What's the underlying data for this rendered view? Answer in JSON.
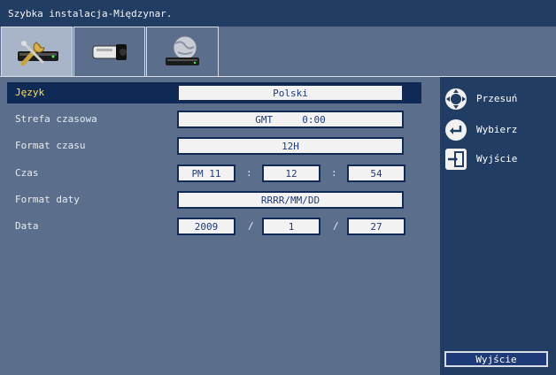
{
  "window": {
    "title": "Szybka instalacja-Międzynar."
  },
  "tabs": [
    {
      "name": "tools-tab",
      "icon": "wrench-device-icon",
      "active": true
    },
    {
      "name": "camera-tab",
      "icon": "camera-icon",
      "active": false
    },
    {
      "name": "network-tab",
      "icon": "globe-network-icon",
      "active": false
    }
  ],
  "settings": {
    "language": {
      "label": "Język",
      "value": "Polski"
    },
    "timezone": {
      "label": "Strefa czasowa",
      "value": "GMT     0:00"
    },
    "time_format": {
      "label": "Format czasu",
      "value": "12H"
    },
    "time": {
      "label": "Czas",
      "hour": "PM 11",
      "minute": "12",
      "second": "54",
      "sep": ":"
    },
    "date_format": {
      "label": "Format daty",
      "value": "RRRR/MM/DD"
    },
    "date": {
      "label": "Data",
      "year": "2009",
      "month": "1",
      "day": "27",
      "sep": "/"
    }
  },
  "sidebar": {
    "move": {
      "label": "Przesuń",
      "icon": "dpad-icon"
    },
    "select": {
      "label": "Wybierz",
      "icon": "enter-icon"
    },
    "exit": {
      "label": "Wyjście",
      "icon": "exit-icon"
    },
    "exit_button": "Wyjście"
  },
  "colors": {
    "title_bar": "#213d63",
    "panel": "#5b6e8c",
    "selection": "#0f2a55",
    "selected_label": "#ffe24a",
    "field_text": "#1f3b7c"
  }
}
